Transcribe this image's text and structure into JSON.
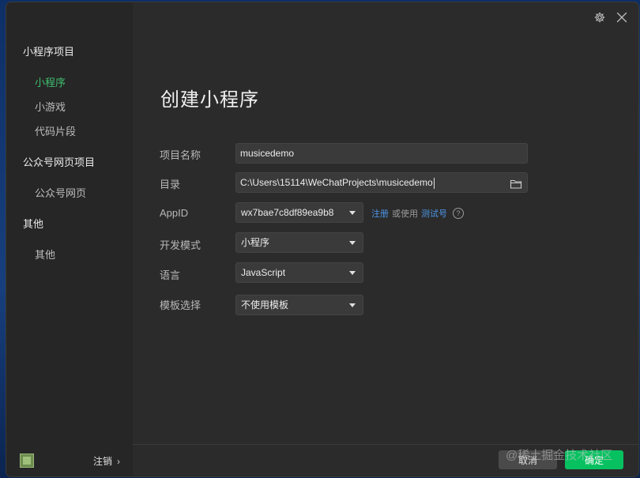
{
  "sidebar": {
    "groups": [
      {
        "title": "小程序项目",
        "items": [
          {
            "label": "小程序"
          },
          {
            "label": "小游戏"
          },
          {
            "label": "代码片段"
          }
        ]
      },
      {
        "title": "公众号网页项目",
        "items": [
          {
            "label": "公众号网页"
          }
        ]
      },
      {
        "title": "其他",
        "items": [
          {
            "label": "其他"
          }
        ]
      }
    ],
    "footer": {
      "logout_label": "注销",
      "chevron": "›"
    }
  },
  "header": {
    "icons": {
      "settings": "gear-icon",
      "close": "close-icon"
    }
  },
  "main": {
    "title": "创建小程序",
    "form": {
      "project_name": {
        "label": "项目名称",
        "value": "musicedemo"
      },
      "directory": {
        "label": "目录",
        "value": "C:\\Users\\15114\\WeChatProjects\\musicedemo"
      },
      "appid": {
        "label": "AppID",
        "value": "wx7bae7c8df89ea9b8",
        "register_link": "注册",
        "or_use_text": "或使用",
        "test_link": "测试号",
        "help": "?"
      },
      "dev_mode": {
        "label": "开发模式",
        "value": "小程序"
      },
      "language": {
        "label": "语言",
        "value": "JavaScript"
      },
      "template": {
        "label": "模板选择",
        "value": "不使用模板"
      }
    }
  },
  "footer": {
    "cancel_label": "取消",
    "confirm_label": "确定",
    "watermark": "@稀土掘金技术社区"
  },
  "colors": {
    "accent": "#3fbf6e",
    "confirm": "#07c160",
    "link": "#4d97e8",
    "background": "#2b2b2b"
  }
}
